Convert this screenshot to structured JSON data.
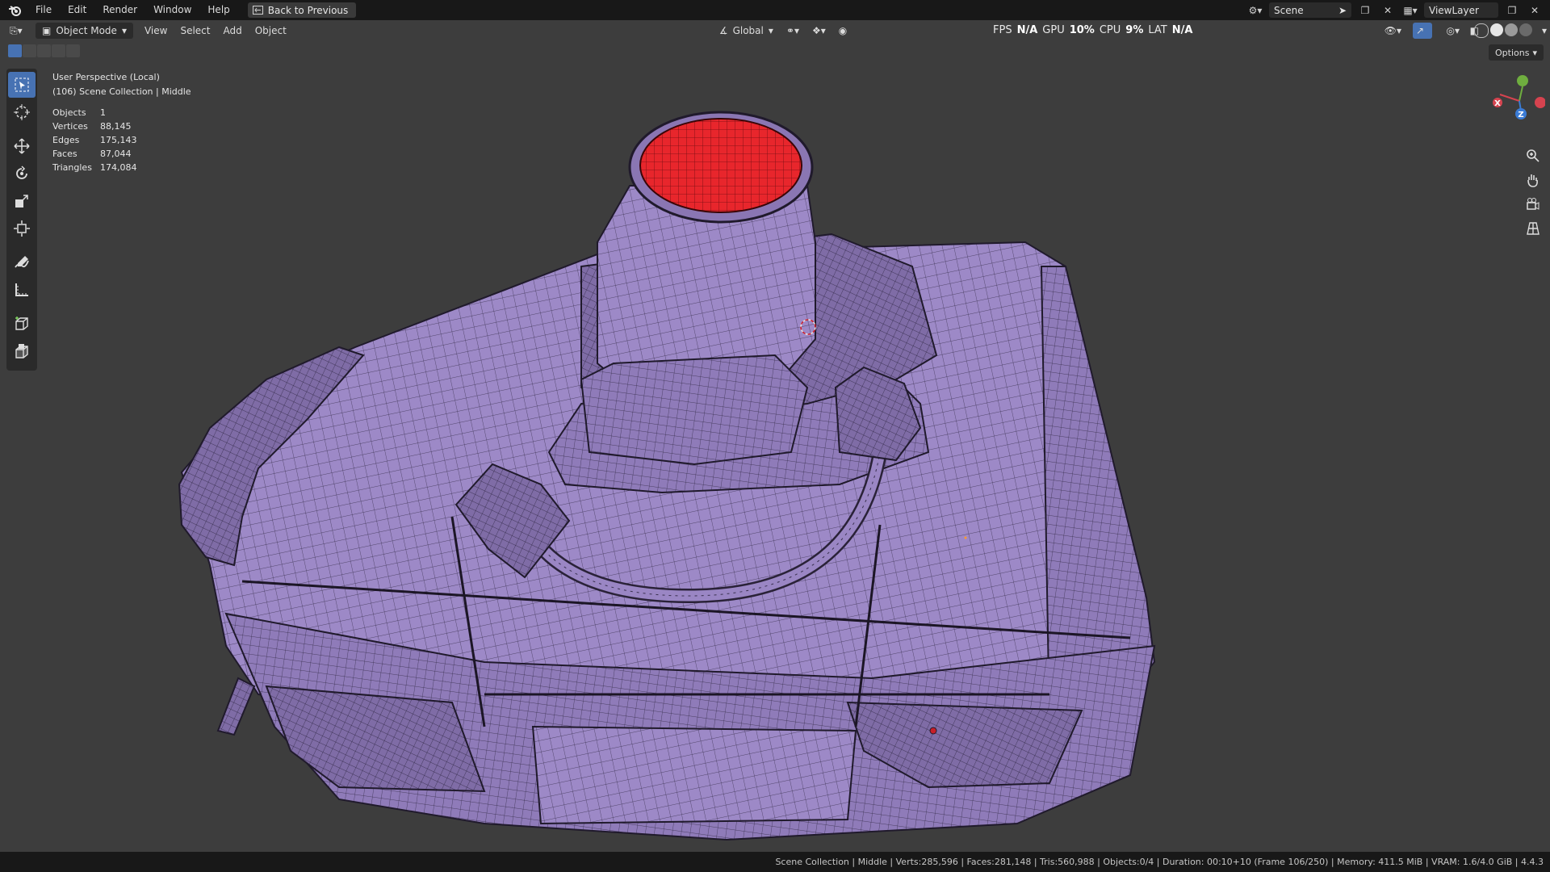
{
  "menu": {
    "items": [
      "File",
      "Edit",
      "Render",
      "Window",
      "Help"
    ],
    "back_button": "Back to Previous"
  },
  "top_right": {
    "scene_label": "Scene",
    "view_layer_label": "ViewLayer"
  },
  "viewport_header": {
    "mode": "Object Mode",
    "menu_items": [
      "View",
      "Select",
      "Add",
      "Object"
    ],
    "orientation": "Global",
    "options_label": "Options"
  },
  "performance": {
    "fps_label": "FPS",
    "fps_value": "N/A",
    "gpu_label": "GPU",
    "gpu_value": "10%",
    "cpu_label": "CPU",
    "cpu_value": "9%",
    "lat_label": "LAT",
    "lat_value": "N/A"
  },
  "viewport_info": {
    "perspective": "User Perspective (Local)",
    "collection": "(106) Scene Collection | Middle"
  },
  "scene_stats": [
    {
      "key": "Objects",
      "value": "1"
    },
    {
      "key": "Vertices",
      "value": "88,145"
    },
    {
      "key": "Edges",
      "value": "175,143"
    },
    {
      "key": "Faces",
      "value": "87,044"
    },
    {
      "key": "Triangles",
      "value": "174,084"
    }
  ],
  "tools": [
    "select-box-tool",
    "cursor-tool",
    "move-tool",
    "rotate-tool",
    "scale-tool",
    "transform-tool",
    "annotate-tool",
    "measure-tool",
    "add-cube-tool",
    "extrude-tool"
  ],
  "gizmo_axes": {
    "x": "X",
    "y": "Y",
    "z": "Z"
  },
  "colors": {
    "mesh": "#9a86c4",
    "wire": "#2b2438",
    "selected_face": "#e8262c",
    "viewport_bg": "#3d3d3d",
    "accent": "#4772b3"
  },
  "statusbar": {
    "text": "Scene Collection | Middle | Verts:285,596 | Faces:281,148 | Tris:560,988 | Objects:0/4 | Duration: 00:10+10 (Frame 106/250) | Memory: 411.5 MiB | VRAM: 1.6/4.0 GiB | 4.4.3"
  }
}
